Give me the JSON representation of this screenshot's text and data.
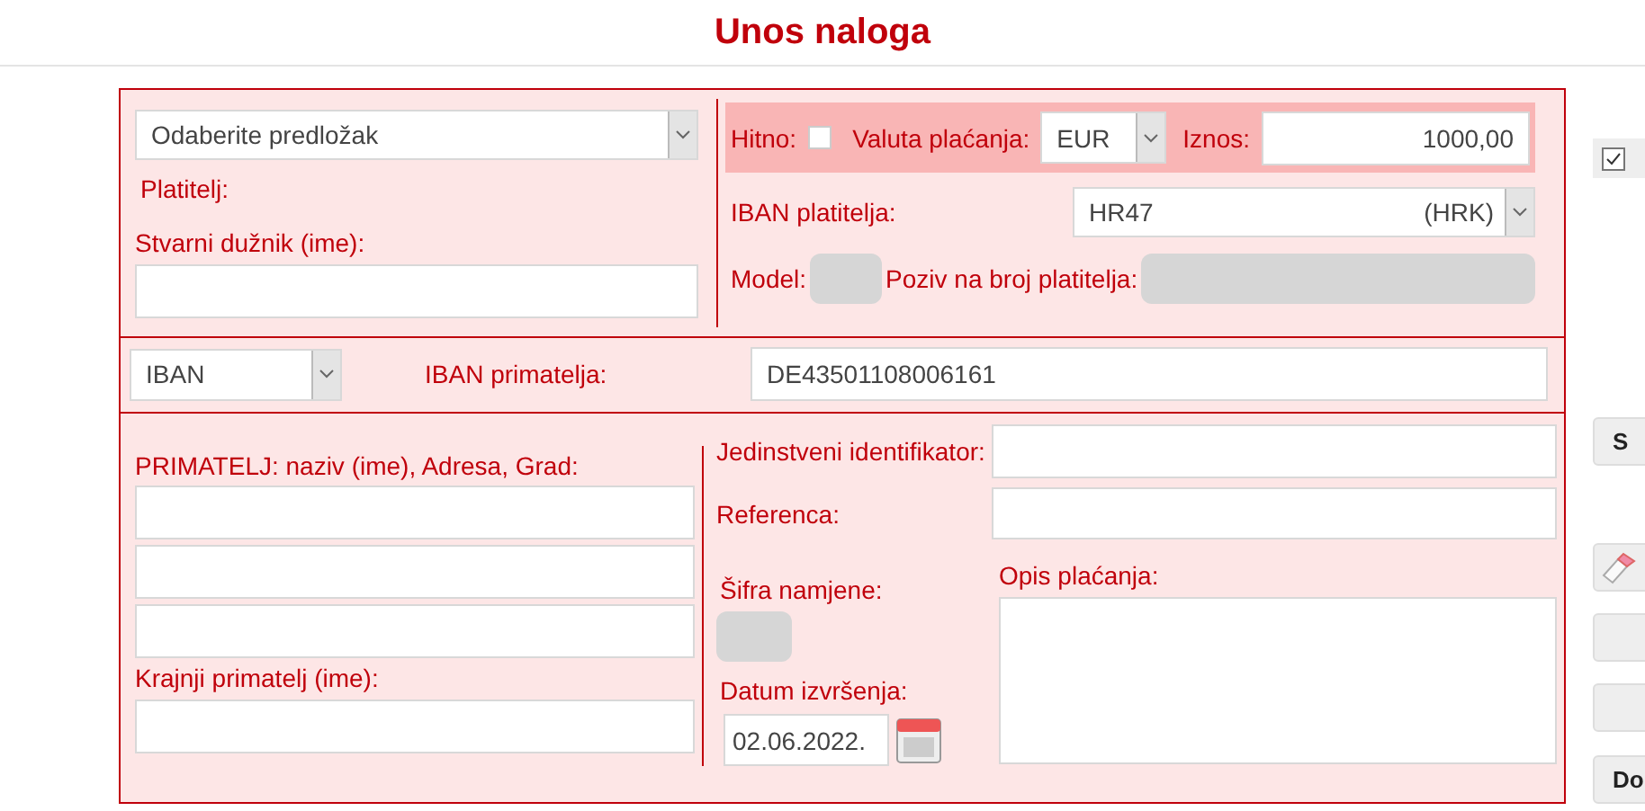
{
  "title": "Unos naloga",
  "template": {
    "value": "Odaberite predložak"
  },
  "payer": {
    "label": "Platitelj:"
  },
  "actual_debtor": {
    "label": "Stvarni dužnik (ime):"
  },
  "urgent": {
    "label": "Hitno:",
    "checked": false
  },
  "currency": {
    "label": "Valuta plaćanja:",
    "value": "EUR"
  },
  "amount": {
    "label": "Iznos:",
    "value": "1000,00"
  },
  "payer_iban": {
    "label": "IBAN platitelja:",
    "value": "HR47",
    "suffix": "(HRK)"
  },
  "model": {
    "label": "Model:",
    "disabled": true
  },
  "payer_reference": {
    "label": "Poziv na broj platitelja:",
    "disabled": true
  },
  "account_type": {
    "value": "IBAN"
  },
  "payee_iban": {
    "label": "IBAN primatelja:",
    "value": "DE43501108006161"
  },
  "payee": {
    "label": "PRIMATELJ: naziv (ime), Adresa, Grad:"
  },
  "final_payee": {
    "label": "Krajnji primatelj (ime):"
  },
  "unique_identifier": {
    "label": "Jedinstveni identifikator:"
  },
  "reference": {
    "label": "Referenca:"
  },
  "purpose_code": {
    "label": "Šifra namjene:",
    "disabled": true
  },
  "execution_date": {
    "label": "Datum izvršenja:",
    "value": "02.06.2022."
  },
  "description": {
    "label": "Opis plaćanja:"
  },
  "side": {
    "checkbox": {
      "checked": true
    },
    "buttons": [
      {
        "kind": "text",
        "label": "S"
      },
      {
        "kind": "eraser"
      },
      {
        "kind": "blank"
      },
      {
        "kind": "blank"
      },
      {
        "kind": "text",
        "label": "Do"
      }
    ]
  }
}
